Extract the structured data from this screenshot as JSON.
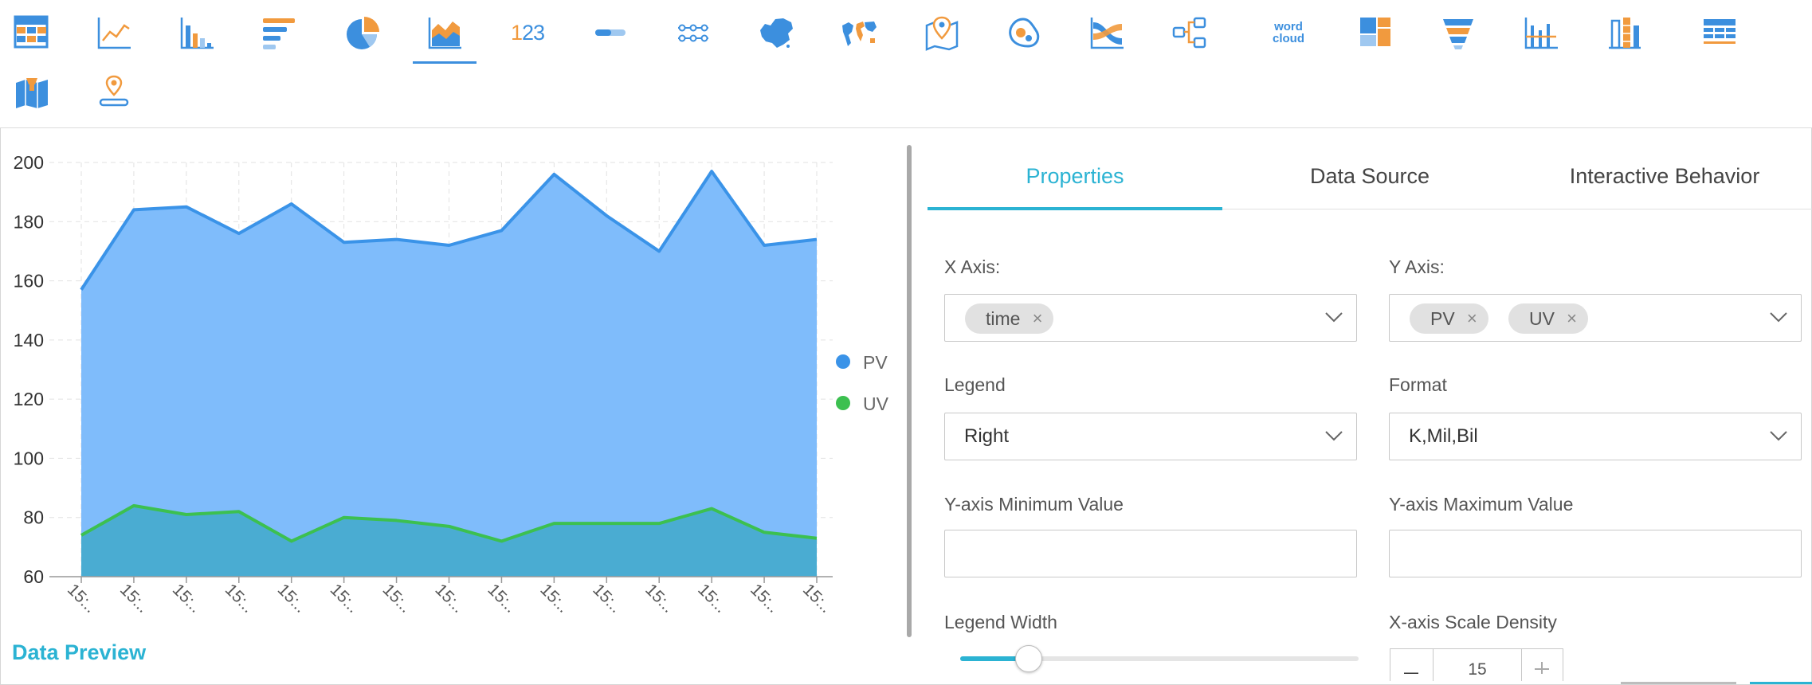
{
  "toolbar": {
    "tools": [
      {
        "id": "table",
        "label": "Table"
      },
      {
        "id": "line",
        "label": "Line Chart"
      },
      {
        "id": "bar",
        "label": "Column Chart"
      },
      {
        "id": "hbar",
        "label": "Bar Chart"
      },
      {
        "id": "pie",
        "label": "Pie Chart"
      },
      {
        "id": "area",
        "label": "Area Chart",
        "active": true
      },
      {
        "id": "kpi",
        "label": "123"
      },
      {
        "id": "progress",
        "label": "Progress Bar"
      },
      {
        "id": "funnel-steps",
        "label": "Step Chart"
      },
      {
        "id": "china-map",
        "label": "China Map"
      },
      {
        "id": "world-map",
        "label": "World Map"
      },
      {
        "id": "pin-map",
        "label": "Pin Map"
      },
      {
        "id": "bubble-map",
        "label": "Bubble Map"
      },
      {
        "id": "sankey",
        "label": "Sankey"
      },
      {
        "id": "tree",
        "label": "Tree"
      },
      {
        "id": "word-cloud",
        "label_1": "word",
        "label_2": "cloud"
      },
      {
        "id": "treemap",
        "label": "Treemap"
      },
      {
        "id": "funnel",
        "label": "Funnel"
      },
      {
        "id": "combo",
        "label": "Combo"
      },
      {
        "id": "stacked",
        "label": "Stacked"
      },
      {
        "id": "crosstab",
        "label": "Crosstab"
      },
      {
        "id": "color-map",
        "label": "Color Map"
      },
      {
        "id": "flow-map",
        "label": "Flow Map"
      }
    ],
    "kpi_text_a": "1",
    "kpi_text_b": "23",
    "word_cloud_1": "word",
    "word_cloud_2": "cloud"
  },
  "colors": {
    "accent": "#2bb3d3",
    "pv_line": "#3a93e8",
    "pv_fill": "#7fbcfb",
    "uv_line": "#3cc050",
    "uv_fill": "#4aacd2",
    "icon_blue": "#3c8fde",
    "icon_orange": "#f19a3e"
  },
  "chart_data": {
    "type": "area",
    "y_ticks": [
      "200",
      "180",
      "160",
      "140",
      "120",
      "100",
      "80",
      "60"
    ],
    "ylim": [
      60,
      200
    ],
    "x_tick_label": "15:..",
    "x_count": 15,
    "series": [
      {
        "name": "PV",
        "values": [
          157,
          184,
          185,
          176,
          186,
          173,
          174,
          172,
          177,
          196,
          182,
          170,
          197,
          172,
          174
        ]
      },
      {
        "name": "UV",
        "values": [
          74,
          84,
          81,
          82,
          72,
          80,
          79,
          77,
          72,
          78,
          78,
          78,
          83,
          75,
          73
        ]
      }
    ],
    "legend_position": "right",
    "grid": true
  },
  "data_preview_label": "Data Preview",
  "panel": {
    "tabs": [
      "Properties",
      "Data Source",
      "Interactive Behavior"
    ],
    "x_axis": {
      "label": "X Axis:",
      "tags": [
        "time"
      ]
    },
    "y_axis": {
      "label": "Y Axis:",
      "tags": [
        "PV",
        "UV"
      ]
    },
    "legend": {
      "label": "Legend",
      "value": "Right"
    },
    "format": {
      "label": "Format",
      "value": "K,Mil,Bil"
    },
    "y_min": {
      "label": "Y-axis Minimum Value",
      "value": ""
    },
    "y_max": {
      "label": "Y-axis Maximum Value",
      "value": ""
    },
    "legend_width": {
      "label": "Legend Width",
      "value": 0.17
    },
    "x_density": {
      "label": "X-axis Scale Density",
      "value": "15"
    }
  }
}
